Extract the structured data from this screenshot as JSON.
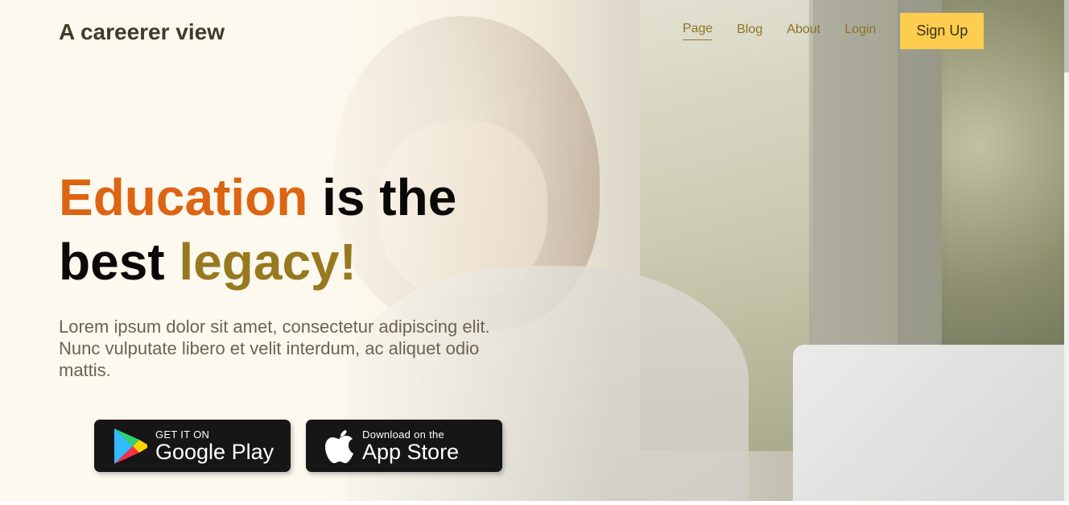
{
  "header": {
    "brand": "A careerer view",
    "nav": {
      "items": [
        {
          "label": "Page",
          "active": true
        },
        {
          "label": "Blog",
          "active": false
        },
        {
          "label": "About",
          "active": false
        },
        {
          "label": "Login",
          "active": false
        }
      ],
      "signup_label": "Sign Up"
    }
  },
  "hero": {
    "headline": {
      "part1": "Education",
      "part2": " is the",
      "part3": "best ",
      "part4": "legacy!"
    },
    "subtext": "Lorem ipsum dolor sit amet, consectetur adipiscing elit. Nunc vulputate libero et velit interdum, ac aliquet odio mattis.",
    "badges": {
      "google_play": {
        "small": "GET IT ON",
        "big": "Google Play",
        "icon": "google-play-icon"
      },
      "app_store": {
        "small": "Download on the",
        "big": "App Store",
        "icon": "apple-icon"
      }
    }
  },
  "colors": {
    "accent_orange": "#dc6413",
    "accent_olive": "#97791f",
    "nav_link": "#8a742a",
    "signup_bg": "#fecd4f",
    "badge_bg": "#161616"
  }
}
